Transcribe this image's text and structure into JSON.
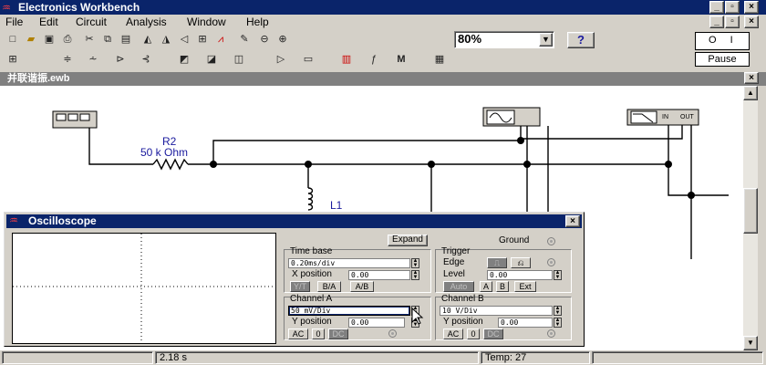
{
  "app": {
    "title": "Electronics Workbench"
  },
  "menu": [
    "File",
    "Edit",
    "Circuit",
    "Analysis",
    "Window",
    "Help"
  ],
  "toolbar": {
    "zoom": "80%",
    "help_label": "?",
    "pause_label": "Pause",
    "power_label": "O I"
  },
  "document": {
    "title": "并联谐振.ewb"
  },
  "circuit": {
    "resistor": {
      "ref": "R2",
      "value": "50 k Ohm"
    },
    "inductor": {
      "ref": "L1"
    },
    "plotter_ports": [
      "IN",
      "OUT"
    ]
  },
  "status": {
    "time": "2.18 s",
    "temp": "Temp:  27"
  },
  "oscilloscope": {
    "title": "Oscilloscope",
    "expand_label": "Expand",
    "ground_label": "Ground",
    "timebase": {
      "title": "Time base",
      "value": "0.20ms/div",
      "xpos_label": "X position",
      "xpos": "0.00",
      "modes": [
        "Y/T",
        "B/A",
        "A/B"
      ]
    },
    "trigger": {
      "title": "Trigger",
      "edge_label": "Edge",
      "level_label": "Level",
      "level": "0.00",
      "sources": [
        "Auto",
        "A",
        "B",
        "Ext"
      ]
    },
    "channel_a": {
      "title": "Channel A",
      "value": "50 mV/Div",
      "ypos_label": "Y position",
      "ypos": "0.00",
      "coupling": [
        "AC",
        "0",
        "DC"
      ]
    },
    "channel_b": {
      "title": "Channel B",
      "value": "10  V/Div",
      "ypos_label": "Y position",
      "ypos": "0.00",
      "coupling": [
        "AC",
        "0",
        "DC"
      ]
    }
  },
  "colors": {
    "titlebar": "#0a246a",
    "wire": "#000000",
    "component_label": "#1a1a9e",
    "face": "#d4d0c8"
  }
}
